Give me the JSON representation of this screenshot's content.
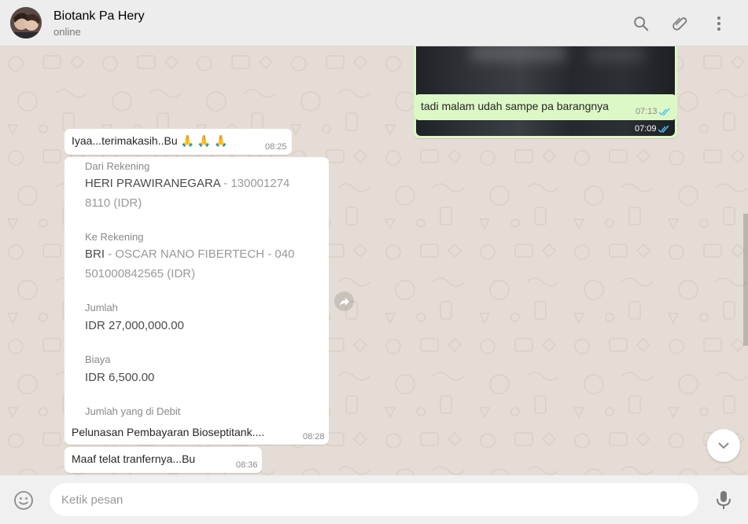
{
  "header": {
    "contact_name": "Biotank Pa Hery",
    "contact_status": "online",
    "icons": [
      "search-icon",
      "attach-icon",
      "menu-icon"
    ]
  },
  "messages": {
    "image_time": "07:09",
    "out_text": "tadi malam udah sampe pa barangnya",
    "out_time": "07:13",
    "thanks_text": "Iyaa...terimakasih..Bu 🙏 🙏 🙏",
    "thanks_time": "08:25",
    "transfer": {
      "from_label": "Dari Rekening",
      "from_name": "HERI PRAWIRANEGARA",
      "from_account_line1": " - 130001274",
      "from_account_line2": "8110 (IDR)",
      "to_label": "Ke Rekening",
      "to_bank": "BRI",
      "to_account_line1": " - OSCAR NANO FIBERTECH - 040",
      "to_account_line2": "501000842565 (IDR)",
      "amount_label": "Jumlah",
      "amount_value": "IDR 27,000,000.00",
      "fee_label": "Biaya",
      "fee_value": "IDR 6,500.00",
      "debit_label": "Jumlah yang di Debit",
      "caption": "Pelunasan Pembayaran Bioseptitank....",
      "time": "08:28"
    },
    "sorry_text": "Maaf telat tranfernya...Bu",
    "sorry_time": "08:36"
  },
  "composer": {
    "placeholder": "Ketik pesan"
  },
  "colors": {
    "chat_bg": "#e5ddd5",
    "outgoing_bubble": "#dcf8c6",
    "incoming_bubble": "#ffffff",
    "read_ticks": "#4fc3f7"
  }
}
